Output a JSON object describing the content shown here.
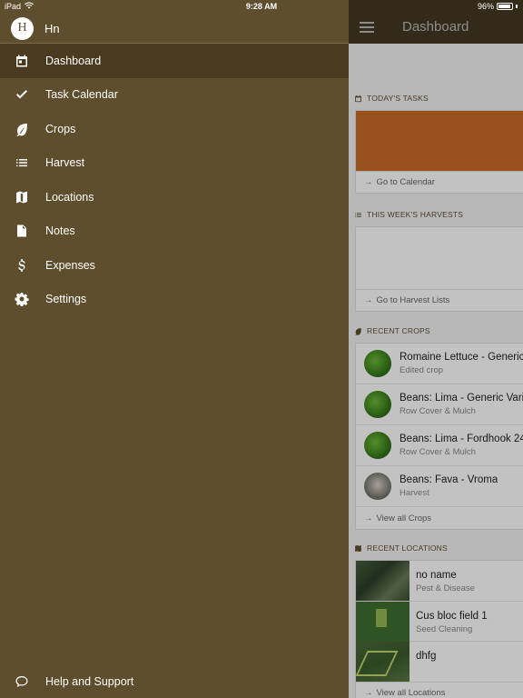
{
  "status_bar": {
    "device": "iPad",
    "time": "9:28 AM",
    "battery": "96%",
    "battery_level": 0.96
  },
  "drawer": {
    "user_initial": "H",
    "user_name": "Hn",
    "items": [
      {
        "label": "Dashboard",
        "icon": "calendar-icon",
        "active": true
      },
      {
        "label": "Task Calendar",
        "icon": "check-icon"
      },
      {
        "label": "Crops",
        "icon": "leaf-icon"
      },
      {
        "label": "Harvest",
        "icon": "list-icon"
      },
      {
        "label": "Locations",
        "icon": "map-icon"
      },
      {
        "label": "Notes",
        "icon": "note-icon"
      },
      {
        "label": "Expenses",
        "icon": "dollar-icon"
      },
      {
        "label": "Settings",
        "icon": "gear-icon"
      }
    ],
    "help_label": "Help and Support"
  },
  "main": {
    "title": "Dashboard",
    "tasks": {
      "heading": "TODAY'S TASKS",
      "link": "Go to Calendar",
      "accent": "#c86b26"
    },
    "harvests": {
      "heading": "THIS WEEK'S HARVESTS",
      "link": "Go to Harvest Lists"
    },
    "crops": {
      "heading": "RECENT CROPS",
      "items": [
        {
          "title": "Romaine Lettuce - Generic",
          "subtitle": "Edited crop"
        },
        {
          "title": "Beans: Lima - Generic Vari",
          "subtitle": "Row Cover & Mulch"
        },
        {
          "title": "Beans: Lima - Fordhook 24",
          "subtitle": "Row Cover & Mulch"
        },
        {
          "title": "Beans: Fava - Vroma",
          "subtitle": "Harvest"
        }
      ],
      "link": "View all Crops"
    },
    "locations": {
      "heading": "RECENT LOCATIONS",
      "items": [
        {
          "title": "no name",
          "subtitle": "Pest & Disease"
        },
        {
          "title": "Cus bloc field 1",
          "subtitle": "Seed Cleaning"
        },
        {
          "title": "dhfg",
          "subtitle": ""
        }
      ],
      "link": "View all Locations"
    }
  },
  "colors": {
    "brand": "#5f4e2e",
    "active": "#4a3b20"
  }
}
